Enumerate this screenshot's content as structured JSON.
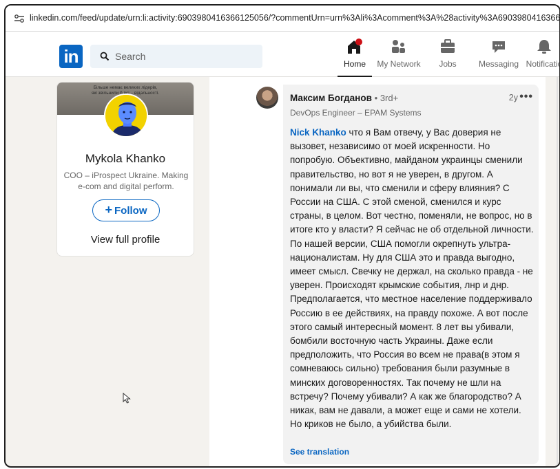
{
  "browser": {
    "url": "linkedin.com/feed/update/urn:li:activity:6903980416366125056/?commentUrn=urn%3Ali%3Acomment%3A%28activity%3A690398041636612"
  },
  "nav": {
    "search_placeholder": "Search",
    "items": [
      {
        "label": "Home",
        "icon": "home-icon"
      },
      {
        "label": "My Network",
        "icon": "network-icon"
      },
      {
        "label": "Jobs",
        "icon": "briefcase-icon"
      },
      {
        "label": "Messaging",
        "icon": "messaging-icon"
      },
      {
        "label": "Notificatio",
        "icon": "bell-icon"
      }
    ],
    "logo": "in"
  },
  "profile": {
    "banner_text": "Більше немає великих лідерів,\nякі звільнили б всі... відальності.\n...Бауман",
    "name": "Mykola Khanko",
    "headline": "COO – iProspect Ukraine. Making e-com and digital perform.",
    "follow_label": "Follow",
    "view_profile_label": "View full profile"
  },
  "comment": {
    "author": "Максим Богданов",
    "degree": "• 3rd+",
    "time": "2y",
    "more": "•••",
    "headline": "DevOps Engineer – EPAM Systems",
    "mention": "Nick Khanko",
    "text": " что я Вам отвечу, у Вас доверия не вызовет, независимо от моей искренности. Но попробую. Объективно, майданом украинцы сменили правительство, но вот я не уверен, в другом. А понимали ли вы, что сменили и сферу влияния? С России на США. С этой сменой, сменился и курс страны, в целом. Вот честно, поменяли, не вопрос, но в итоге кто у власти? Я сейчас не об отдельной личности. По нашей версии, США помогли окрепнуть ультра-националистам. Ну для США это и правда выгодно, имеет смысл. Свечку не держал, на сколько правда - не уверен. Происходят крымские события, лнр и днр. Предполагается, что местное население поддерживало Россию в ее действиях, на правду похоже. А вот после этого самый интересный момент. 8 лет вы убивали, бомбили восточную часть Украины. Даже если предположить, что Россия во всем не права(в этом я сомневаюсь сильно) требования были разумные в минских договоренностях. Так почему не шли на встречу? Почему убивали? А как же благородство? А никак, вам не давали, а может еще и сами не хотели. Но криков не было, а убийства были.",
    "see_translation": "See translation"
  },
  "colors": {
    "brand": "#0a66c2",
    "page_bg": "#f4f2ee",
    "bubble_bg": "#f2f2f2"
  }
}
